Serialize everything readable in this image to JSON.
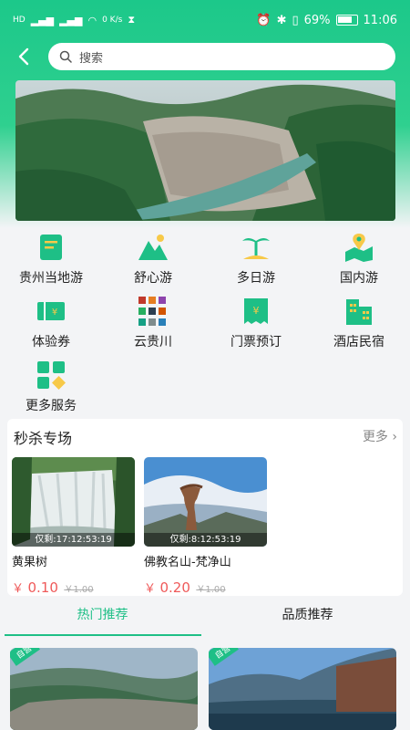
{
  "status_bar": {
    "left_indicators": [
      "HD",
      "4G",
      "4G",
      "0 K/s"
    ],
    "battery": "69%",
    "time": "11:06"
  },
  "search": {
    "placeholder": "搜索"
  },
  "services": [
    {
      "label": "贵州当地游",
      "icon": "book-icon"
    },
    {
      "label": "舒心游",
      "icon": "mountain-icon"
    },
    {
      "label": "多日游",
      "icon": "palm-icon"
    },
    {
      "label": "国内游",
      "icon": "map-pin-icon"
    },
    {
      "label": "体验券",
      "icon": "ticket-icon"
    },
    {
      "label": "云贵川",
      "icon": "stickers-icon"
    },
    {
      "label": "门票预订",
      "icon": "ticket-booking-icon"
    },
    {
      "label": "酒店民宿",
      "icon": "hotel-icon"
    },
    {
      "label": "更多服务",
      "icon": "grid-icon"
    }
  ],
  "flash_sale": {
    "title": "秒杀专场",
    "more": "更多",
    "deals": [
      {
        "name": "黄果树",
        "timer": "仅剩:17:12:53:19",
        "currency": "￥",
        "price": "0.10",
        "original": "￥1.00"
      },
      {
        "name": "佛教名山-梵净山",
        "timer": "仅剩:8:12:53:19",
        "currency": "￥",
        "price": "0.20",
        "original": "￥1.00"
      }
    ]
  },
  "tabs": [
    {
      "label": "热门推荐",
      "active": true
    },
    {
      "label": "品质推荐",
      "active": false
    }
  ],
  "cards": [
    {
      "tag": "自营"
    },
    {
      "tag": "自营"
    }
  ],
  "colors": {
    "accent": "#1ebf86",
    "price": "#ef5a5a"
  }
}
